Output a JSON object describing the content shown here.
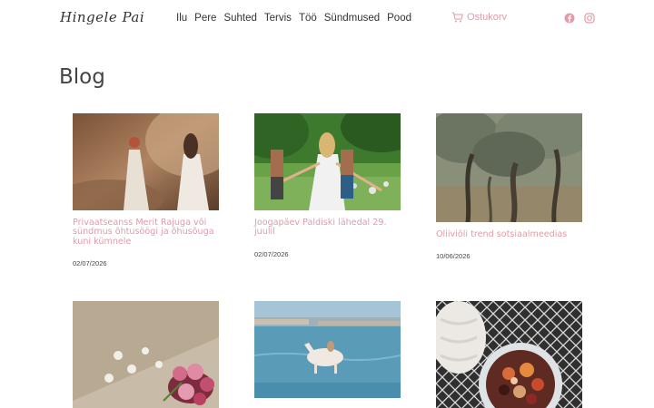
{
  "header": {
    "logo": "Hingele Pai",
    "nav": [
      "Ilu",
      "Pere",
      "Suhted",
      "Tervis",
      "Töö",
      "Sündmused",
      "Pood"
    ],
    "cart_label": "Ostukorv",
    "social": [
      "facebook-icon",
      "instagram-icon"
    ]
  },
  "page": {
    "title": "Blog"
  },
  "posts": [
    {
      "title": "Privaatseanss Merit Rajuga või sündmus õhtusöögi ja õhusõuga kuni kümnele",
      "date": "02/07/2026"
    },
    {
      "title": "Joogapäev Paldiski lähedal 29. juulil",
      "date": "02/07/2026"
    },
    {
      "title": "Oliiviõli trend sotsiaalmeedias",
      "date": "10/06/2026"
    },
    {
      "title": "",
      "date": ""
    },
    {
      "title": "",
      "date": ""
    },
    {
      "title": "",
      "date": ""
    }
  ],
  "colors": {
    "accent": "#e29aa6",
    "text": "#3d3d3d"
  }
}
